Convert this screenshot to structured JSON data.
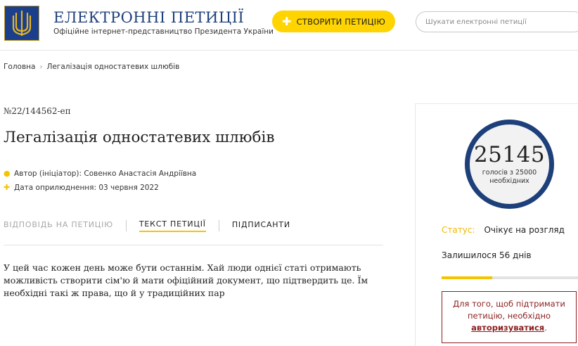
{
  "header": {
    "site_title": "ЕЛЕКТРОННІ ПЕТИЦІЇ",
    "site_subtitle": "Офіційне інтернет-представництво Президента України",
    "create_button": "СТВОРИТИ ПЕТИЦІЮ",
    "search_placeholder": "Шукати електронні петиції"
  },
  "breadcrumb": {
    "home": "Головна",
    "current": "Легалізація одностатевих шлюбів"
  },
  "petition": {
    "number": "№22/144562-еп",
    "title": "Легалізація одностатевих шлюбів",
    "author": "Автор (ініціатор): Совенко Анастасія Андріївна",
    "date": "Дата оприлюднення: 03 червня 2022",
    "body": "У цей час кожен день може бути останнім. Хай люди однієї статі отримають можливість створити сім'ю й мати офіційний документ, що підтвердить це. Їм необхідні такі ж права, що й у традиційних пар"
  },
  "tabs": {
    "response": "ВІДПОВІДЬ НА ПЕТИЦІЮ",
    "text": "ТЕКСТ ПЕТИЦІЇ",
    "signers": "ПІДПИСАНТИ"
  },
  "sidebar": {
    "votes": "25145",
    "votes_caption": "голосів з 25000 необхідних",
    "status_label": "Статус:",
    "status_value": "Очікує на розгляд",
    "remaining": "Залишилося 56 днів",
    "remaining_fraction": 0.37,
    "auth_text": "Для того, щоб підтримати петицію, необхідно",
    "auth_link": "авторизуватися",
    "auth_suffix": "."
  },
  "colors": {
    "brand_blue": "#1d3f7a",
    "accent_yellow": "#f5c400",
    "alert_red": "#8b1e1e"
  },
  "icons": {
    "author": "person-icon",
    "date": "plus-icon",
    "emblem": "trident-emblem-icon"
  }
}
